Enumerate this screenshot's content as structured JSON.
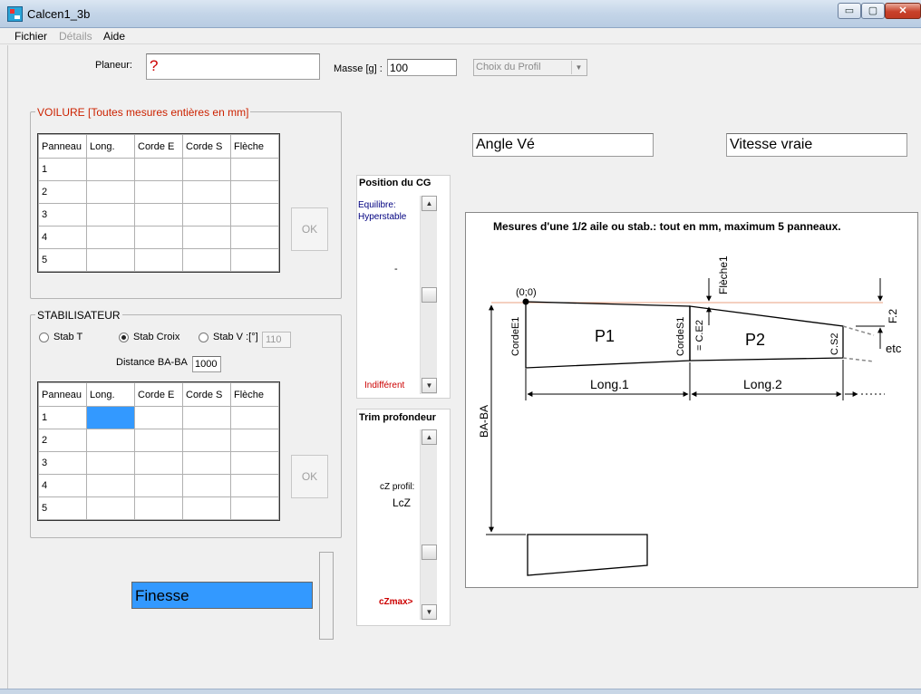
{
  "window": {
    "title": "Calcen1_3b",
    "minimize": "▭",
    "maximize": "▢",
    "close": "✕"
  },
  "menu": {
    "fichier": "Fichier",
    "details": "Détails",
    "aide": "Aide"
  },
  "planeur": {
    "label": "Planeur:",
    "value": "?"
  },
  "masse": {
    "label": "Masse [g] :",
    "value": "100"
  },
  "profil": {
    "value": "Choix du Profil"
  },
  "voilure": {
    "title": "VOILURE  [Toutes mesures entières en mm]",
    "columns": [
      "Panneau",
      "Long.",
      "Corde E",
      "Corde S",
      "Flèche"
    ],
    "rows": [
      "1",
      "2",
      "3",
      "4",
      "5"
    ],
    "ok": "OK"
  },
  "stab": {
    "title": "STABILISATEUR",
    "stab_t": "Stab T",
    "stab_croix": "Stab Croix",
    "stab_v": "Stab V :[°]",
    "stab_v_value": "110",
    "distance_label": "Distance BA-BA",
    "distance_value": "1000",
    "selected": "stab_croix",
    "columns": [
      "Panneau",
      "Long.",
      "Corde E",
      "Corde S",
      "Flèche"
    ],
    "rows": [
      "1",
      "2",
      "3",
      "4",
      "5"
    ],
    "ok": "OK"
  },
  "finesse": "Finesse",
  "angle_ve": "Angle Vé",
  "vitesse": "Vitesse vraie",
  "cg": {
    "title": "Position du CG",
    "equilibre": "Equilibre:",
    "hyperstable": "Hyperstable",
    "dash": "-",
    "indifferent": "Indifférent"
  },
  "trim": {
    "title": "Trim profondeur",
    "cz_profil": "cZ profil:",
    "lcz": "LcZ",
    "czmax": "cZmax>"
  },
  "diagram": {
    "title": "Mesures  d'une 1/2 aile ou stab.: tout en mm, maximum 5 panneaux.",
    "origin": "(0;0)",
    "fleche1": "Flèche1",
    "corde_e1": "CordeE1",
    "corde_s1": "CordeS1",
    "eq_ce2": "= C.E2",
    "p1": "P1",
    "p2": "P2",
    "cs2": "C.S2",
    "f2": "F.2",
    "etc": "etc",
    "long1": "Long.1",
    "long2": "Long.2",
    "baba": "BA-BA"
  },
  "colors": {
    "voilure_title": "#cc2200",
    "finesse_bg": "#3399ff",
    "cg_equilibre": "#000080",
    "indifferent": "#cc0000",
    "ref_line": "#e8a080"
  }
}
